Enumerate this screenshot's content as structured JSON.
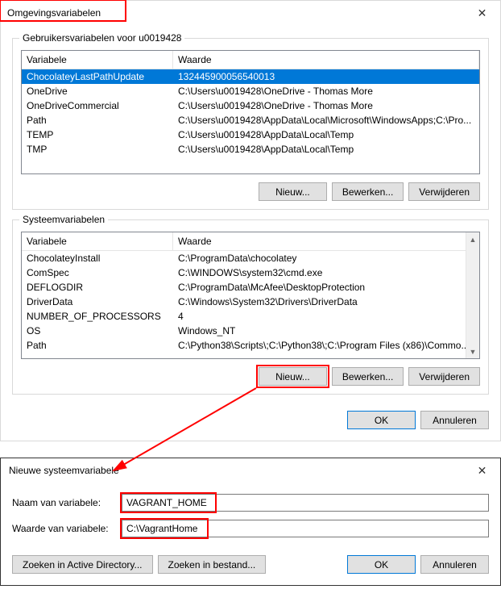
{
  "envDialog": {
    "title": "Omgevingsvariabelen",
    "userGroupTitle": "Gebruikersvariabelen voor u0019428",
    "colName": "Variabele",
    "colValue": "Waarde",
    "userRows": [
      {
        "name": "ChocolateyLastPathUpdate",
        "value": "132445900056540013",
        "selected": true
      },
      {
        "name": "OneDrive",
        "value": "C:\\Users\\u0019428\\OneDrive - Thomas More"
      },
      {
        "name": "OneDriveCommercial",
        "value": "C:\\Users\\u0019428\\OneDrive - Thomas More"
      },
      {
        "name": "Path",
        "value": "C:\\Users\\u0019428\\AppData\\Local\\Microsoft\\WindowsApps;C:\\Pro..."
      },
      {
        "name": "TEMP",
        "value": "C:\\Users\\u0019428\\AppData\\Local\\Temp"
      },
      {
        "name": "TMP",
        "value": "C:\\Users\\u0019428\\AppData\\Local\\Temp"
      }
    ],
    "systemGroupTitle": "Systeemvariabelen",
    "systemRows": [
      {
        "name": "ChocolateyInstall",
        "value": "C:\\ProgramData\\chocolatey"
      },
      {
        "name": "ComSpec",
        "value": "C:\\WINDOWS\\system32\\cmd.exe"
      },
      {
        "name": "DEFLOGDIR",
        "value": "C:\\ProgramData\\McAfee\\DesktopProtection"
      },
      {
        "name": "DriverData",
        "value": "C:\\Windows\\System32\\Drivers\\DriverData"
      },
      {
        "name": "NUMBER_OF_PROCESSORS",
        "value": "4"
      },
      {
        "name": "OS",
        "value": "Windows_NT"
      },
      {
        "name": "Path",
        "value": "C:\\Python38\\Scripts\\;C:\\Python38\\;C:\\Program Files (x86)\\Commo..."
      }
    ],
    "btnNew": "Nieuw...",
    "btnEdit": "Bewerken...",
    "btnDelete": "Verwijderen",
    "btnOk": "OK",
    "btnCancel": "Annuleren"
  },
  "newVarDialog": {
    "title": "Nieuwe systeemvariabele",
    "labelName": "Naam van variabele:",
    "labelValue": "Waarde van variabele:",
    "inputName": "VAGRANT_HOME",
    "inputValue": "C:\\VagrantHome",
    "btnBrowseAD": "Zoeken in Active Directory...",
    "btnBrowseFile": "Zoeken in bestand...",
    "btnOk": "OK",
    "btnCancel": "Annuleren"
  }
}
